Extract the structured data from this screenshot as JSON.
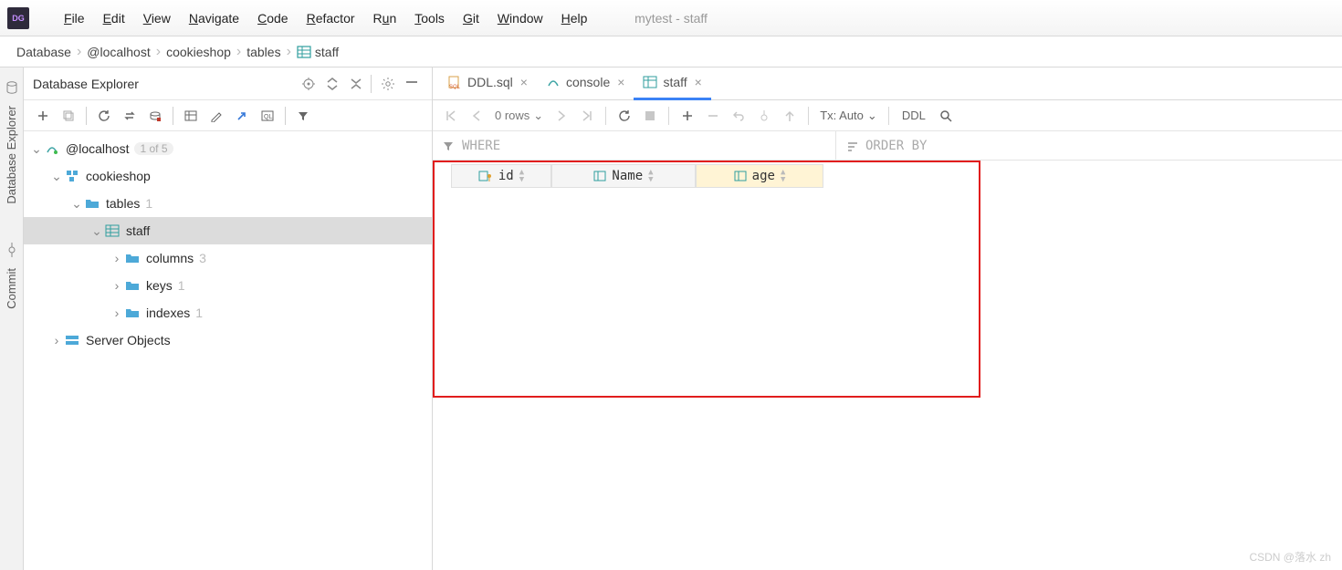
{
  "window": {
    "title": "mytest - staff"
  },
  "menu": [
    "File",
    "Edit",
    "View",
    "Navigate",
    "Code",
    "Refactor",
    "Run",
    "Tools",
    "Git",
    "Window",
    "Help"
  ],
  "breadcrumb": [
    "Database",
    "@localhost",
    "cookieshop",
    "tables",
    "staff"
  ],
  "sidebar_tools": {
    "db_explorer": "Database Explorer",
    "commit": "Commit"
  },
  "explorer": {
    "title": "Database Explorer",
    "tree": {
      "host": "@localhost",
      "host_badge": "1 of 5",
      "schema": "cookieshop",
      "tables_label": "tables",
      "tables_count": "1",
      "table": "staff",
      "columns_label": "columns",
      "columns_count": "3",
      "keys_label": "keys",
      "keys_count": "1",
      "indexes_label": "indexes",
      "indexes_count": "1",
      "server_objects": "Server Objects"
    }
  },
  "tabs": [
    {
      "label": "DDL.sql",
      "icon": "sql"
    },
    {
      "label": "console",
      "icon": "console"
    },
    {
      "label": "staff",
      "icon": "table",
      "active": true
    }
  ],
  "data_toolbar": {
    "rows": "0 rows",
    "tx": "Tx: Auto",
    "ddl": "DDL"
  },
  "filters": {
    "where": "WHERE",
    "order": "ORDER BY"
  },
  "columns": [
    "id",
    "Name",
    "age"
  ],
  "watermark": "CSDN @落水 zh"
}
